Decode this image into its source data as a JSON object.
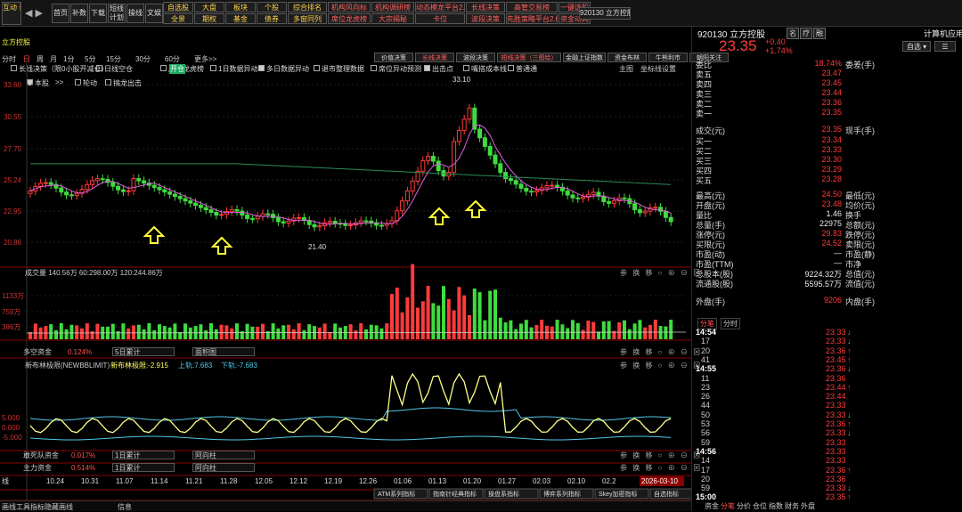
{
  "toolbar": {
    "logo": "互动\n课堂",
    "nav": [
      "首页",
      "补数",
      "下载",
      "短线\n计划",
      "操线",
      "文娱"
    ],
    "menu_row1": [
      "自选股",
      "大盘",
      "板块",
      "个股",
      "综合排名",
      "机构风向标",
      "机构调研榜",
      "动态模龙平台2.0",
      "长线决策",
      "高管交易榜",
      "一键选股"
    ],
    "menu_row2": [
      "全景",
      "期权",
      "基金",
      "债券",
      "多窗同列",
      "席位龙虎榜",
      "大宗揭秘",
      "卡位",
      "波段决策",
      "先胜策略平台2.0",
      "资金动向"
    ],
    "stock_box": "920130 立方控股"
  },
  "chart_header": {
    "name": "立方控股",
    "periods": [
      "分时",
      "日",
      "周",
      "月",
      "1分",
      "5分",
      "15分",
      "30分",
      "60分",
      "更多>>"
    ],
    "period_active": "日",
    "mid_tabs": [
      "价值决策",
      "长线决策",
      "波段决策",
      "短线决策（三图绘）",
      "金融上证指数",
      "资金布林",
      "牛熊利市",
      "朝阳关注"
    ],
    "tools": [
      "主图",
      "坐标线",
      "设置"
    ],
    "options_row1": [
      "长线决策（限0小股开减仓）",
      "日线空仓",
      "席位龙虎榜",
      "1日数据异动",
      "多日数据异动",
      "退市整理数据",
      "席位异动预测",
      "出击点",
      "嘴搭成本线",
      "普通通"
    ],
    "options_row2": [
      "本股",
      ">>",
      "轮动",
      "搞龙出击"
    ],
    "option_badge": "开仓"
  },
  "main_chart": {
    "y_ticks": [
      "33.60",
      "30.55",
      "27.75",
      "25.24",
      "22.95",
      "20.86"
    ],
    "high_label": "33.10",
    "low_label": "21.40"
  },
  "volume": {
    "header": "成交量  140.56万  60:298.00万  120:244.86万",
    "y_ticks": [
      "1133万",
      "759万",
      "386万"
    ]
  },
  "indicator1": {
    "name": "多空资金",
    "value": "0.124%",
    "drop1": "5日累计",
    "drop2": "面积图"
  },
  "indicator2": {
    "name": "新布林极限(NEWBBLIMIT)",
    "main": "新布林极限:-2.915",
    "up": "上轨:7.683",
    "down": "下轨:-7.683",
    "y_ticks": [
      "5.000",
      "0.000",
      "-5.000"
    ]
  },
  "indicator3": {
    "name": "敢死队资金",
    "value": "0.017%",
    "drop1": "1日累计",
    "drop2": "阿向柱"
  },
  "indicator4": {
    "name": "主力资金",
    "value": "0.514%",
    "drop1": "1日累计",
    "drop2": "阿向柱"
  },
  "pane_icons": "参 换 移 ○ ⊕ ⊖ ⊠",
  "x_axis": {
    "prefix": "线",
    "dates": [
      "10.24",
      "10.31",
      "11.07",
      "11.14",
      "11.21",
      "11.28",
      "12.05",
      "12.12",
      "12.19",
      "12.26",
      "01.06",
      "01.13",
      "01.20",
      "01.27",
      "02.03",
      "02.10",
      "02.2"
    ],
    "cursor_date": "2026-03-10"
  },
  "bottom_tabs": [
    "ATM系列指标",
    "指南针经典指标",
    "操盘系指标",
    "博弈系列指标",
    "Skey加密指标",
    "自选指标"
  ],
  "statusbar": [
    "画线工具",
    "指标",
    "隐藏画线",
    "信息"
  ],
  "quote": {
    "code": "920130",
    "name": "立方控股",
    "badges": [
      "名",
      "疗",
      "融"
    ],
    "right_label": "计算机应用",
    "price": "23.35",
    "change": "+0.40",
    "pct": "+1.74%",
    "add": "自选",
    "asks": [
      [
        "卖五",
        "23.47"
      ],
      [
        "卖四",
        "23.45"
      ],
      [
        "卖三",
        "23.44"
      ],
      [
        "卖二",
        "23.36"
      ],
      [
        "卖一",
        "23.35"
      ]
    ],
    "weibi": "委比",
    "weibi_v": "18.74%",
    "weicha": "委差(手)",
    "deal": "成交(元)",
    "deal_v": "23.35",
    "now_hand": "现手(手)",
    "bids": [
      [
        "买一",
        "23.34"
      ],
      [
        "买二",
        "23.33"
      ],
      [
        "买三",
        "23.30"
      ],
      [
        "买四",
        "23.29"
      ],
      [
        "买五",
        "23.28"
      ]
    ],
    "stats": [
      [
        "最高(元)",
        "24.50",
        "最低(元)",
        ""
      ],
      [
        "开盘(元)",
        "23.48",
        "均价(元)",
        ""
      ],
      [
        "量比",
        "1.46",
        "换手",
        ""
      ],
      [
        "总量(手)",
        "22975",
        "总额(元)",
        ""
      ],
      [
        "涨停(元)",
        "29.83",
        "跌停(元)",
        ""
      ],
      [
        "买限(元)",
        "24.52",
        "卖限(元)",
        ""
      ],
      [
        "市盈(动)",
        "—",
        "市盈(静)",
        ""
      ],
      [
        "市盈(TTM)",
        "—",
        "市净",
        ""
      ],
      [
        "总股本(股)",
        "9224.32万",
        "总值(元)",
        ""
      ],
      [
        "流通股(股)",
        "5595.57万",
        "流值(元)",
        ""
      ]
    ],
    "outer": "外盘(手)",
    "outer_v": "9206",
    "inner": "内盘(手)",
    "trade_tabs": [
      "分笔",
      "分时"
    ],
    "trades": [
      [
        "14:54",
        "23.33",
        "↓"
      ],
      [
        "17",
        "23.33",
        "↓"
      ],
      [
        "20",
        "23.36",
        "↑"
      ],
      [
        "41",
        "23.45",
        "↑"
      ],
      [
        "14:55",
        "23.36",
        "↓"
      ],
      [
        "11",
        "23.36",
        ""
      ],
      [
        "23",
        "23.44",
        "↑"
      ],
      [
        "26",
        "23.44",
        ""
      ],
      [
        "44",
        "23.33",
        ""
      ],
      [
        "50",
        "23.33",
        "↓"
      ],
      [
        "53",
        "23.36",
        "↑"
      ],
      [
        "56",
        "23.33",
        "↓"
      ],
      [
        "59",
        "23.33",
        ""
      ],
      [
        "14:56",
        "23.33",
        ""
      ],
      [
        "14",
        "23.33",
        ""
      ],
      [
        "17",
        "23.36",
        "↑"
      ],
      [
        "20",
        "23.36",
        ""
      ],
      [
        "59",
        "23.33",
        "↓"
      ],
      [
        "15:00",
        "23.35",
        "↑"
      ]
    ],
    "bottom_tabs": [
      "资金",
      "分笔",
      "分价",
      "仓位",
      "指数",
      "财务",
      "外盘"
    ]
  },
  "colors": {
    "up": "#ff3b3b",
    "down": "#3fdc3f",
    "ma": "#e060e0",
    "ma2": "#2e8b57",
    "bg": "#000000",
    "frame": "#8b0000"
  }
}
